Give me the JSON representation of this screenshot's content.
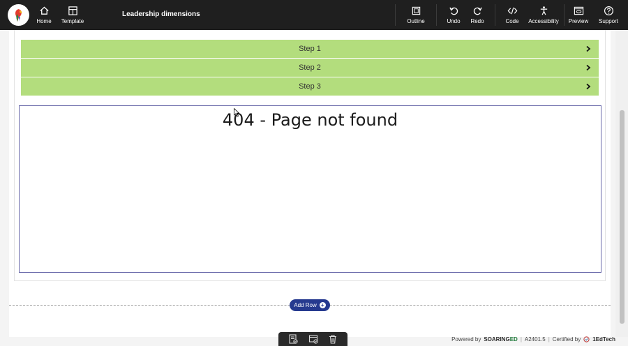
{
  "header": {
    "title": "Leadership dimensions",
    "left_buttons": [
      {
        "label": "Home",
        "icon": "home-icon"
      },
      {
        "label": "Template",
        "icon": "template-icon"
      }
    ],
    "right_buttons": [
      {
        "label": "Outline",
        "icon": "outline-icon"
      },
      {
        "label": "Undo",
        "icon": "undo-icon"
      },
      {
        "label": "Redo",
        "icon": "redo-icon"
      },
      {
        "label": "Code",
        "icon": "code-icon"
      },
      {
        "label": "Accessibility",
        "icon": "accessibility-icon"
      },
      {
        "label": "Preview",
        "icon": "preview-icon"
      },
      {
        "label": "Support",
        "icon": "support-icon"
      }
    ]
  },
  "steps": [
    {
      "label": "Step 1"
    },
    {
      "label": "Step 2"
    },
    {
      "label": "Step 3"
    }
  ],
  "embed": {
    "error_text": "404 - Page not found"
  },
  "add_row": {
    "label": "Add Row"
  },
  "footer": {
    "powered_by": "Powered by",
    "brand_a": "SOARING",
    "brand_b": "ED",
    "version": "A2401.5",
    "certified_by": "Certified by",
    "certifier": "1EdTech"
  },
  "colors": {
    "topbar": "#1f1f1f",
    "step_bg": "#b3dd7d",
    "add_row_bg": "#263a8f",
    "frame_border": "#6a6aaa"
  }
}
